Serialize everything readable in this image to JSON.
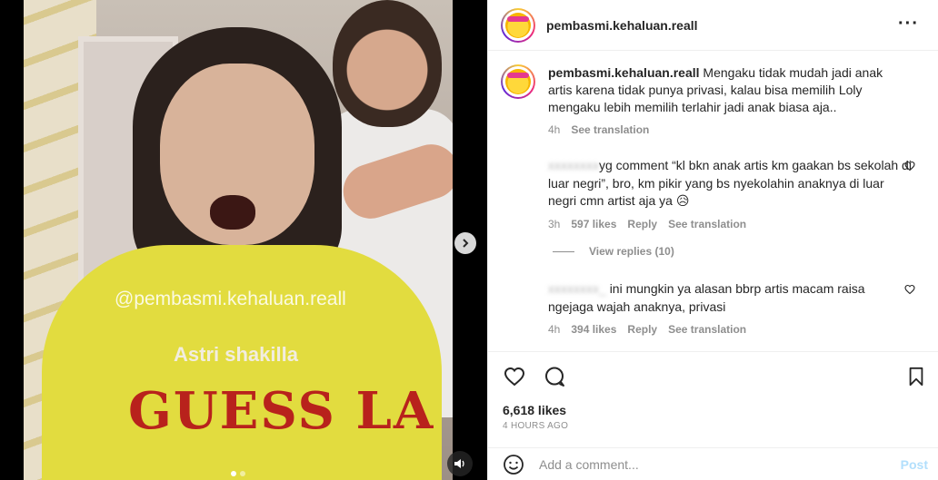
{
  "post": {
    "username": "pembasmi.kehaluan.reall",
    "more_icon": "more-horizontal-icon"
  },
  "media": {
    "watermark": "@pembasmi.kehaluan.reall",
    "overlay_caption": "Astri shakilla",
    "shirt_text": "GUESS LA",
    "next_icon": "chevron-right-icon",
    "mute_icon": "speaker-icon",
    "carousel_index": 1,
    "carousel_count": 2
  },
  "caption": {
    "username": "pembasmi.kehaluan.reall",
    "text": "Mengaku tidak mudah jadi anak artis karena tidak punya privasi, kalau bisa memilih Loly mengaku lebih memilih terlahir jadi anak biasa aja..",
    "time": "4h",
    "see_translation": "See translation"
  },
  "comments": [
    {
      "username_hidden": "xxxxxxxx",
      "text": "yg comment “kl bkn anak artis km gaakan bs sekolah di luar negri”, bro, km pikir yang bs nyekolahin anaknya di luar negri cmn artist aja ya 😥",
      "time": "3h",
      "likes": "597 likes",
      "reply": "Reply",
      "see_translation": "See translation",
      "view_replies": "View replies (10)"
    },
    {
      "username_hidden": "xxxxxxxx_",
      "text": "ini mungkin ya alasan bbrp artis macam raisa ngejaga wajah anaknya, privasi",
      "time": "4h",
      "likes": "394 likes",
      "reply": "Reply",
      "see_translation": "See translation"
    }
  ],
  "actions": {
    "likes": "6,618 likes",
    "date": "4 HOURS AGO"
  },
  "add_comment": {
    "placeholder": "Add a comment...",
    "post_label": "Post"
  }
}
